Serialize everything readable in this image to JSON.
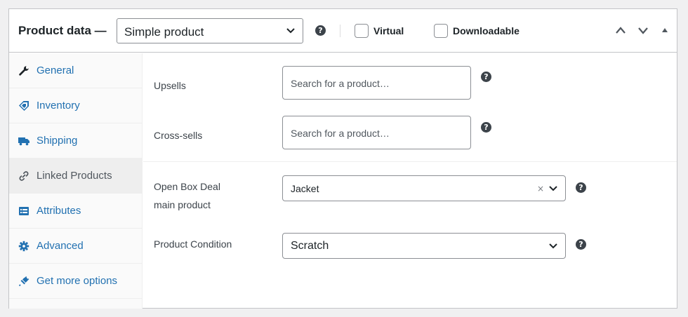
{
  "header": {
    "title": "Product data —",
    "product_type": "Simple product",
    "virtual_label": "Virtual",
    "downloadable_label": "Downloadable",
    "help_glyph": "?"
  },
  "sidebar": {
    "items": [
      {
        "label": "General",
        "icon": "wrench-icon"
      },
      {
        "label": "Inventory",
        "icon": "tag-icon"
      },
      {
        "label": "Shipping",
        "icon": "truck-icon"
      },
      {
        "label": "Linked Products",
        "icon": "link-icon",
        "active": true
      },
      {
        "label": "Attributes",
        "icon": "list-icon"
      },
      {
        "label": "Advanced",
        "icon": "gear-icon"
      },
      {
        "label": "Get more options",
        "icon": "plugin-icon"
      }
    ]
  },
  "linked": {
    "upsells_label": "Upsells",
    "upsells_placeholder": "Search for a product…",
    "crosssells_label": "Cross-sells",
    "crosssells_placeholder": "Search for a product…"
  },
  "custom": {
    "open_box_label_line1": "Open Box Deal",
    "open_box_label_line2": "main product",
    "open_box_value": "Jacket",
    "clear_glyph": "×",
    "condition_label": "Product Condition",
    "condition_value": "Scratch"
  },
  "colors": {
    "link": "#2271b1",
    "text": "#1d2327",
    "border": "#c3c4c7",
    "icon": "#3c434a"
  }
}
